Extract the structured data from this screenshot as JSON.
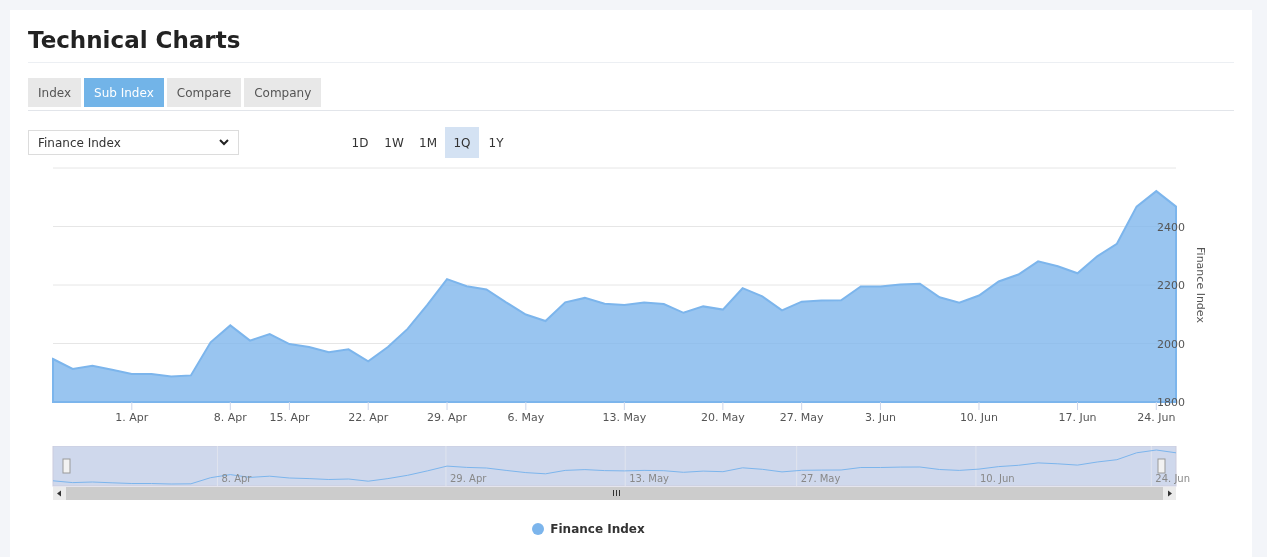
{
  "title": "Technical Charts",
  "tabs": [
    {
      "label": "Index",
      "selected": false
    },
    {
      "label": "Sub Index",
      "selected": true
    },
    {
      "label": "Compare",
      "selected": false
    },
    {
      "label": "Company",
      "selected": false
    }
  ],
  "index_select": {
    "value": "Finance Index"
  },
  "ranges": [
    {
      "label": "1D",
      "selected": false
    },
    {
      "label": "1W",
      "selected": false
    },
    {
      "label": "1M",
      "selected": false
    },
    {
      "label": "1Q",
      "selected": true
    },
    {
      "label": "1Y",
      "selected": false
    }
  ],
  "chart_data": {
    "type": "area",
    "grid": true,
    "ylabel": "Finance Index",
    "ylim": [
      1800,
      2600
    ],
    "yticks": [
      1800,
      2000,
      2200,
      2400
    ],
    "categories": [
      null,
      null,
      null,
      null,
      "1. Apr",
      null,
      null,
      null,
      null,
      "8. Apr",
      null,
      null,
      "15. Apr",
      null,
      null,
      null,
      "22. Apr",
      null,
      null,
      null,
      "29. Apr",
      null,
      null,
      null,
      "6. May",
      null,
      null,
      null,
      null,
      "13. May",
      null,
      null,
      null,
      null,
      "20. May",
      null,
      null,
      null,
      "27. May",
      null,
      null,
      null,
      "3. Jun",
      null,
      null,
      null,
      null,
      "10. Jun",
      null,
      null,
      null,
      null,
      "17. Jun",
      null,
      null,
      null,
      "24. Jun",
      null
    ],
    "series": [
      {
        "name": "Finance Index",
        "color": "#7cb5ec",
        "values": [
          1947,
          1913,
          1924,
          1910,
          1896,
          1896,
          1887,
          1891,
          2004,
          2062,
          2010,
          2032,
          1998,
          1988,
          1970,
          1980,
          1939,
          1988,
          2050,
          2132,
          2220,
          2196,
          2185,
          2141,
          2099,
          2077,
          2141,
          2156,
          2136,
          2132,
          2140,
          2135,
          2105,
          2127,
          2116,
          2189,
          2161,
          2113,
          2143,
          2147,
          2148,
          2195,
          2195,
          2202,
          2204,
          2158,
          2140,
          2164,
          2212,
          2236,
          2281,
          2264,
          2240,
          2298,
          2341,
          2468,
          2521,
          2468
        ]
      }
    ]
  },
  "navigator": {
    "labels": [
      "8. Apr",
      "29. Apr",
      "13. May",
      "27. May",
      "10. Jun",
      "24. Jun"
    ]
  }
}
